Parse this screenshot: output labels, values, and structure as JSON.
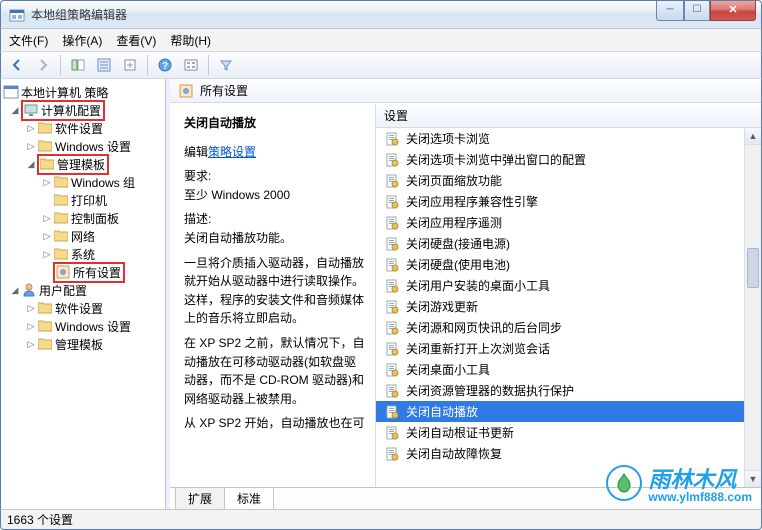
{
  "window": {
    "title": "本地组策略编辑器"
  },
  "menu": {
    "file": "文件(F)",
    "action": "操作(A)",
    "view": "查看(V)",
    "help": "帮助(H)"
  },
  "tree": {
    "root": "本地计算机 策略",
    "computer_config": "计算机配置",
    "software_settings": "软件设置",
    "windows_settings": "Windows 设置",
    "admin_templates": "管理模板",
    "windows_group": "Windows 组",
    "printers": "打印机",
    "control_panel": "控制面板",
    "network": "网络",
    "system": "系统",
    "all_settings": "所有设置",
    "user_config": "用户配置",
    "u_software_settings": "软件设置",
    "u_windows_settings": "Windows 设置",
    "u_admin_templates": "管理模板"
  },
  "right_header": "所有设置",
  "desc": {
    "title": "关闭自动播放",
    "edit_prefix": "编辑",
    "edit_link": "策略设置",
    "req_label": "要求:",
    "req_value": "至少 Windows 2000",
    "desc_label": "描述:",
    "desc_value": "关闭自动播放功能。",
    "para1": "一旦将介质插入驱动器，自动播放就开始从驱动器中进行读取操作。这样，程序的安装文件和音频媒体上的音乐将立即启动。",
    "para2": "在 XP SP2 之前，默认情况下，自动播放在可移动驱动器(如软盘驱动器，而不是 CD-ROM 驱动器)和网络驱动器上被禁用。",
    "para3": "从 XP SP2 开始，自动播放也在可"
  },
  "list": {
    "header": "设置",
    "items": [
      "关闭选项卡浏览",
      "关闭选项卡浏览中弹出窗口的配置",
      "关闭页面缩放功能",
      "关闭应用程序兼容性引擎",
      "关闭应用程序遥测",
      "关闭硬盘(接通电源)",
      "关闭硬盘(使用电池)",
      "关闭用户安装的桌面小工具",
      "关闭游戏更新",
      "关闭源和网页快讯的后台同步",
      "关闭重新打开上次浏览会话",
      "关闭桌面小工具",
      "关闭资源管理器的数据执行保护",
      "关闭自动播放",
      "关闭自动根证书更新",
      "关闭自动故障恢复"
    ],
    "selected_index": 13
  },
  "tabs": {
    "extended": "扩展",
    "standard": "标准"
  },
  "status": "1663 个设置",
  "watermark": {
    "brand": "雨林木风",
    "url": "www.ylmf888.com"
  }
}
